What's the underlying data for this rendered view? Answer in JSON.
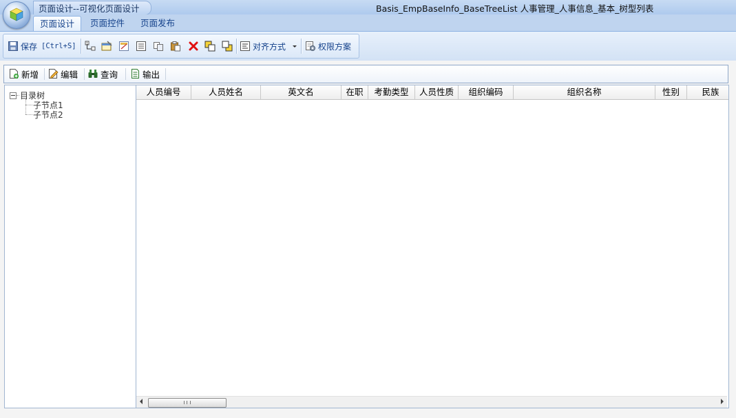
{
  "app": {
    "title": "页面设计--可视化页面设计",
    "window_title": "Basis_EmpBaseInfo_BaseTreeList  人事管理_人事信息_基本_树型列表"
  },
  "ribbon": {
    "tabs": [
      {
        "label": "页面设计",
        "active": true
      },
      {
        "label": "页面控件",
        "active": false
      },
      {
        "label": "页面发布",
        "active": false
      }
    ],
    "save_label": "保存",
    "save_shortcut": "[Ctrl+S]",
    "align_label": "对齐方式",
    "permission_label": "权限方案"
  },
  "toolbar": {
    "add_label": "新增",
    "edit_label": "编辑",
    "query_label": "查询",
    "export_label": "输出"
  },
  "tree": {
    "root": "目录树",
    "children": [
      "子节点1",
      "子节点2"
    ]
  },
  "grid": {
    "columns": [
      "人员编号",
      "人员姓名",
      "英文名",
      "在职",
      "考勤类型",
      "人员性质",
      "组织编码",
      "组织名称",
      "性别",
      "民族"
    ],
    "rows": []
  },
  "scrollbar": {
    "grip": "III"
  },
  "colors": {
    "accent": "#15428b",
    "delete_red": "#e01010"
  }
}
